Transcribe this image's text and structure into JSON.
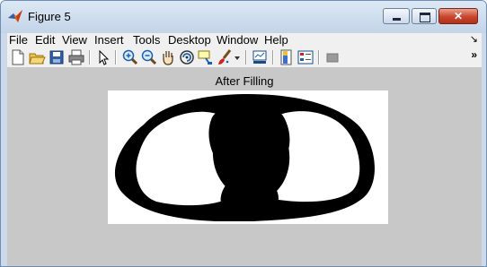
{
  "window": {
    "title": "Figure 5"
  },
  "menubar": {
    "items": [
      "File",
      "Edit",
      "View",
      "Insert",
      "Tools",
      "Desktop",
      "Window",
      "Help"
    ],
    "overflow": "↘"
  },
  "toolbar": {
    "buttons": [
      "new-figure",
      "open-file",
      "save-figure",
      "print-figure",
      "edit-plot",
      "zoom-in",
      "zoom-out",
      "pan",
      "rotate-3d",
      "data-cursor",
      "brush",
      "brush-dropdown",
      "link-plot",
      "insert-colorbar",
      "insert-legend",
      "hide-plot-tools"
    ],
    "overflow": "»"
  },
  "axes": {
    "title": "After Filling"
  },
  "colors": {
    "titlebar": "#c3d4e8",
    "figure_bg": "#c8c8c8",
    "image_fg": "#000000",
    "image_bg": "#ffffff"
  }
}
